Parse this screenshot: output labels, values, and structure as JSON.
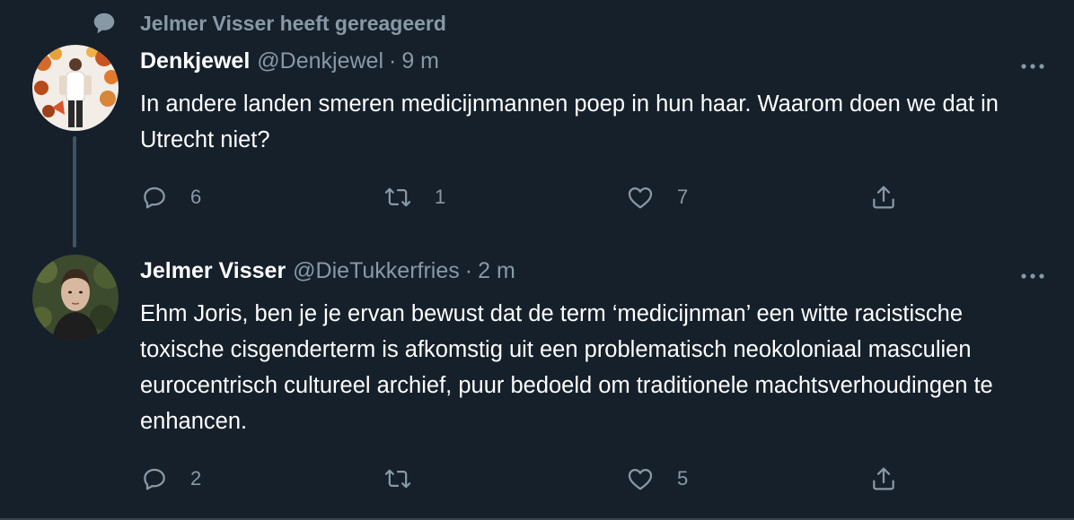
{
  "reply_context": {
    "text": "Jelmer Visser heeft gereageerd",
    "icon": "speech-bubble-icon"
  },
  "tweets": [
    {
      "name": "Denkjewel",
      "handle": "@Denkjewel",
      "separator": "·",
      "time": "9 m",
      "text": "In andere landen smeren medicijnmannen poep in hun haar. Waarom doen we dat in Utrecht niet?",
      "replies": "6",
      "retweets": "1",
      "likes": "7"
    },
    {
      "name": "Jelmer Visser",
      "handle": "@DieTukkerfries",
      "separator": "·",
      "time": "2 m",
      "text": "Ehm Joris, ben je je ervan bewust dat de term ‘medicijnman’ een witte racistische toxische cisgenderterm is afkomstig uit een problematisch neokoloniaal masculien eurocentrisch cultureel archief, puur  bedoeld om traditionele machtsverhoudingen te enhancen.",
      "replies": "2",
      "retweets": "",
      "likes": "5"
    }
  ],
  "colors": {
    "background": "#15202b",
    "primary_text": "#ffffff",
    "secondary_text": "#8899a6",
    "thread_line": "#3d5466"
  }
}
